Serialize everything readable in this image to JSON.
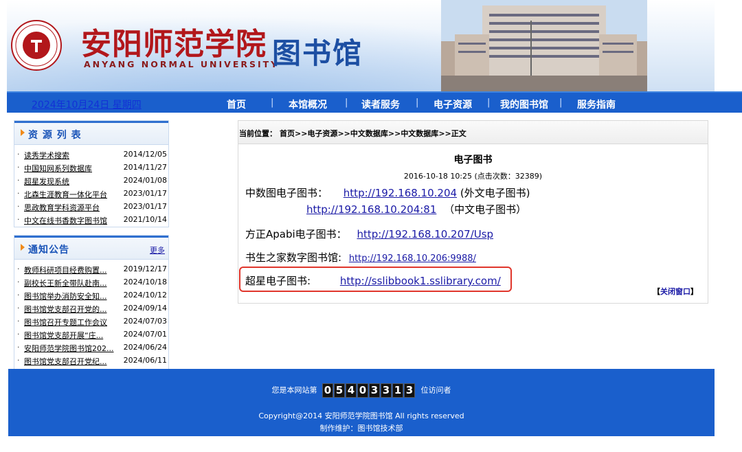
{
  "header": {
    "title_cn": "安阳师范学院",
    "title_en": "ANYANG NORMAL UNIVERSITY",
    "library_cn": "图书馆"
  },
  "nav": {
    "date": "2024年10月24日 星期四",
    "items": [
      "首页",
      "本馆概况",
      "读者服务",
      "电子资源",
      "我的图书馆",
      "服务指南"
    ]
  },
  "resources": {
    "title": "资 源 列 表",
    "items": [
      {
        "name": "读秀学术搜索",
        "date": "2014/12/05"
      },
      {
        "name": "中国知网系列数据库",
        "date": "2014/11/27"
      },
      {
        "name": "超星发现系统",
        "date": "2024/01/08"
      },
      {
        "name": "北森生涯教育一体化平台",
        "date": "2023/01/17"
      },
      {
        "name": "思政教育学科资源平台",
        "date": "2023/01/17"
      },
      {
        "name": "中文在线书香数字图书馆",
        "date": "2021/10/14"
      }
    ]
  },
  "notices": {
    "title": "通知公告",
    "more": "更多",
    "items": [
      {
        "name": "教师科研项目经费购置...",
        "date": "2019/12/17"
      },
      {
        "name": "副校长王新全带队赴南...",
        "date": "2024/10/18"
      },
      {
        "name": "图书馆举办消防安全知...",
        "date": "2024/10/12"
      },
      {
        "name": "图书馆党支部召开党的...",
        "date": "2024/09/14"
      },
      {
        "name": "图书馆召开专题工作会议",
        "date": "2024/07/03"
      },
      {
        "name": "图书馆党支部开展“庄...",
        "date": "2024/07/01"
      },
      {
        "name": "安阳师范学院图书馆202...",
        "date": "2024/06/24"
      },
      {
        "name": "图书馆党支部召开党纪...",
        "date": "2024/06/11"
      }
    ]
  },
  "breadcrumb": {
    "label": "当前位置：",
    "home": "首页",
    "sep": ">>",
    "c1": "电子资源",
    "c2": "中文数据库",
    "c3": "中文数据库",
    "last": "正文"
  },
  "article": {
    "title": "电子图书",
    "meta": "2016-10-18 10:25    (点击次数：32389)",
    "zhongshutu_label": "中数图电子图书：",
    "zhongshutu_url1": "http://192.168.10.204",
    "zhongshutu_note1": "(外文电子图书)",
    "zhongshutu_url2": "http://192.168.10.204:81",
    "zhongshutu_note2": "（中文电子图书）",
    "apabi_label": "方正Apabi电子图书：",
    "apabi_url": "http://192.168.10.207/Usp",
    "shusheng_label": "书生之家数字图书馆:",
    "shusheng_url": "http://192.168.10.206:9988/",
    "chaoxing_label": "超星电子图书:",
    "chaoxing_url": "http://sslibbook1.sslibrary.com/",
    "close_open": "【",
    "close_text": "关闭窗口",
    "close_end": "】"
  },
  "footer": {
    "visit_prefix": "您是本网站第",
    "counter": "05403313",
    "visit_suffix": "位访问者",
    "copyright": "Copyright@2014 安阳师范学院图书馆 All rights reserved",
    "maintainer": "制作维护：图书馆技术部"
  },
  "colors": {
    "nav_blue": "#1a5fcc",
    "title_red": "#b2171b",
    "highlight": "#e0352b"
  }
}
